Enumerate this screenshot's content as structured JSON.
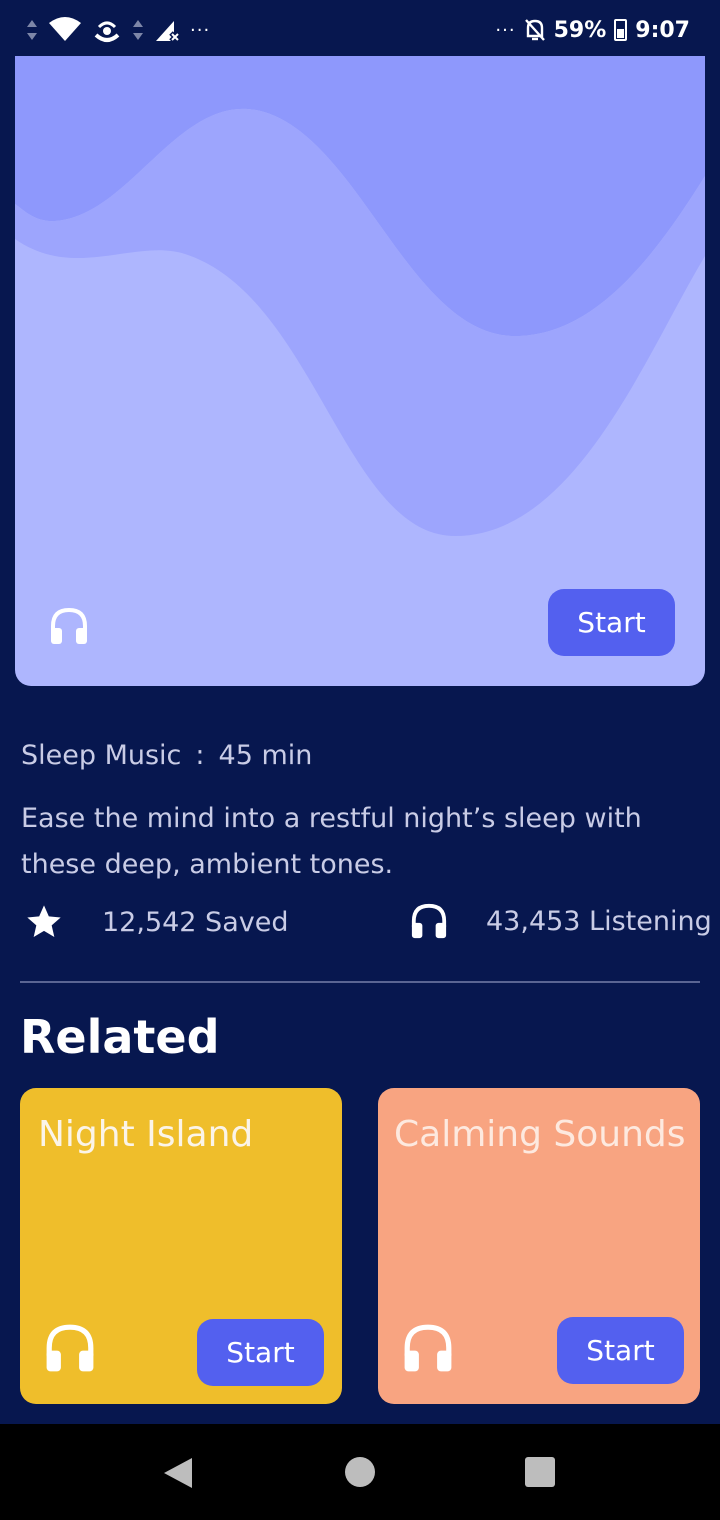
{
  "status_bar": {
    "battery": "59%",
    "time": "9:07",
    "left_dots": "···",
    "right_dots": "···",
    "icons": [
      "data-arrows-icon",
      "wifi-icon",
      "hotspot-icon",
      "data-arrows-icon",
      "signal-icon",
      "bell-off-icon",
      "battery-icon"
    ]
  },
  "hero": {
    "start_label": "Start",
    "color": "#aeb6fe",
    "icon": "headphones-icon"
  },
  "track": {
    "category": "Sleep Music",
    "separator": ":",
    "duration": "45 min",
    "description": "Ease the mind into a restful night’s sleep with these deep, ambient tones."
  },
  "stats": {
    "saved": "12,542 Saved",
    "listening": "43,453 Listening"
  },
  "related": {
    "title": "Related",
    "items": [
      {
        "title": "Night Island",
        "start_label": "Start",
        "color": "#efbe2b"
      },
      {
        "title": "Calming Sounds",
        "start_label": "Start",
        "color": "#f8a481"
      }
    ]
  },
  "nav_bar": {
    "icons": [
      "back-icon",
      "home-icon",
      "recents-icon"
    ]
  },
  "colors": {
    "background": "#07174f",
    "accent": "#5360ef"
  }
}
